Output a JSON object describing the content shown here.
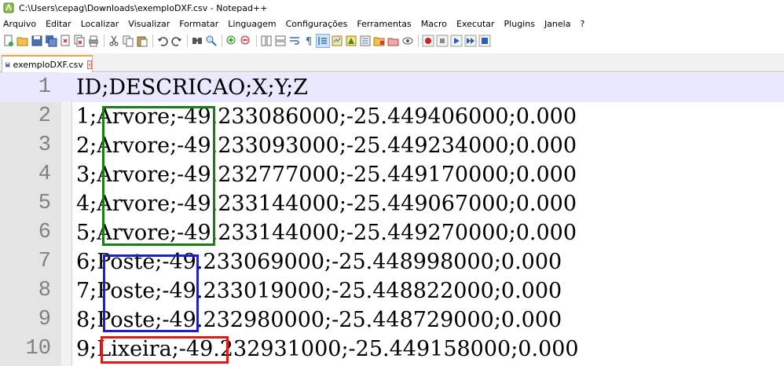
{
  "window": {
    "title": "C:\\Users\\cepag\\Downloads\\exemploDXF.csv - Notepad++",
    "app_icon": "notepadpp-icon"
  },
  "menu": [
    {
      "label": "Arquivo"
    },
    {
      "label": "Editar"
    },
    {
      "label": "Localizar"
    },
    {
      "label": "Visualizar"
    },
    {
      "label": "Formatar"
    },
    {
      "label": "Linguagem"
    },
    {
      "label": "Configurações"
    },
    {
      "label": "Ferramentas"
    },
    {
      "label": "Macro"
    },
    {
      "label": "Executar"
    },
    {
      "label": "Plugins"
    },
    {
      "label": "Janela"
    },
    {
      "label": "?"
    }
  ],
  "toolbar": {
    "icons": [
      "new-file-icon",
      "open-file-icon",
      "save-icon",
      "save-all-icon",
      "close-icon",
      "close-all-icon",
      "print-icon",
      "cut-icon",
      "copy-icon",
      "paste-icon",
      "undo-icon",
      "redo-icon",
      "find-icon",
      "replace-icon",
      "zoom-in-icon",
      "zoom-out-icon",
      "sync-vertical-icon",
      "sync-horizontal-icon",
      "word-wrap-icon",
      "show-all-chars-icon",
      "indent-guide-icon",
      "udl-icon",
      "document-map-icon",
      "function-list-icon",
      "folder-workspace-icon",
      "doc-list-icon",
      "monitoring-icon",
      "record-macro-icon",
      "stop-macro-icon",
      "play-macro-icon",
      "run-macro-multiple-icon",
      "save-macro-icon"
    ]
  },
  "tab": {
    "label": "exemploDXF.csv"
  },
  "editor": {
    "lines": [
      {
        "num": "1",
        "text": "ID;DESCRICAO;X;Y;Z"
      },
      {
        "num": "2",
        "text": "1;Arvore;-49.233086000;-25.449406000;0.000"
      },
      {
        "num": "3",
        "text": "2;Arvore;-49.233093000;-25.449234000;0.000"
      },
      {
        "num": "4",
        "text": "3;Arvore;-49.232777000;-25.449170000;0.000"
      },
      {
        "num": "5",
        "text": "4;Arvore;-49.233144000;-25.449067000;0.000"
      },
      {
        "num": "6",
        "text": "5;Arvore;-49.233144000;-25.449270000;0.000"
      },
      {
        "num": "7",
        "text": "6;Poste;-49.233069000;-25.448998000;0.000"
      },
      {
        "num": "8",
        "text": "7;Poste;-49.233019000;-25.448822000;0.000"
      },
      {
        "num": "9",
        "text": "8;Poste;-49.232980000;-25.448729000;0.000"
      },
      {
        "num": "10",
        "text": "9;Lixeira;-49.232931000;-25.449158000;0.000"
      }
    ],
    "highlights": [
      {
        "category": "Arvore",
        "color": "#1a7d1a"
      },
      {
        "category": "Poste",
        "color": "#1f1fcf"
      },
      {
        "category": "Lixeira",
        "color": "#e01818"
      }
    ]
  }
}
